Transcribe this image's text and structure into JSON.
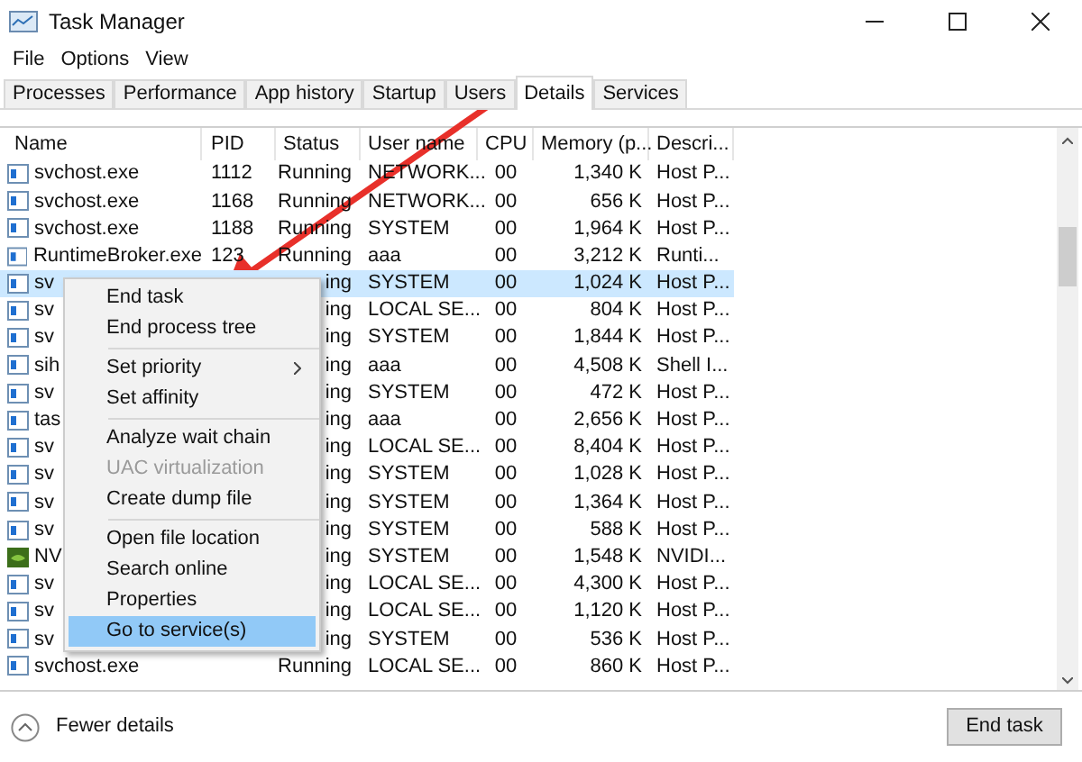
{
  "window": {
    "title": "Task Manager"
  },
  "menu_bar": [
    "File",
    "Options",
    "View"
  ],
  "tabs": [
    {
      "label": "Processes",
      "selected": false
    },
    {
      "label": "Performance",
      "selected": false
    },
    {
      "label": "App history",
      "selected": false
    },
    {
      "label": "Startup",
      "selected": false
    },
    {
      "label": "Users",
      "selected": false
    },
    {
      "label": "Details",
      "selected": true
    },
    {
      "label": "Services",
      "selected": false
    }
  ],
  "table": {
    "columns": [
      "Name",
      "PID",
      "Status",
      "User name",
      "CPU",
      "Memory (p...",
      "Descri..."
    ],
    "rows": [
      {
        "kind": "app",
        "name": "svchost.exe",
        "pid": "1112",
        "status": "Running",
        "user": "NETWORK...",
        "cpu": "00",
        "memory": "1,340 K",
        "description": "Host P...",
        "selected": false
      },
      {
        "kind": "app",
        "name": "svchost.exe",
        "pid": "1168",
        "status": "Running",
        "user": "NETWORK...",
        "cpu": "00",
        "memory": "656 K",
        "description": "Host P...",
        "selected": false
      },
      {
        "kind": "app",
        "name": "svchost.exe",
        "pid": "1188",
        "status": "Running",
        "user": "SYSTEM",
        "cpu": "00",
        "memory": "1,964 K",
        "description": "Host P...",
        "selected": false
      },
      {
        "kind": "app",
        "name": "RuntimeBroker.exe",
        "pid": "123",
        "status": "Running",
        "user": "aaa",
        "cpu": "00",
        "memory": "3,212 K",
        "description": "Runti...",
        "selected": false
      },
      {
        "kind": "app",
        "name": "sv",
        "status": "ing",
        "user": "SYSTEM",
        "cpu": "00",
        "memory": "1,024 K",
        "description": "Host P...",
        "selected": true
      },
      {
        "kind": "app",
        "name": "sv",
        "status": "ing",
        "user": "LOCAL SE...",
        "cpu": "00",
        "memory": "804 K",
        "description": "Host P...",
        "selected": false
      },
      {
        "kind": "app",
        "name": "sv",
        "status": "ing",
        "user": "SYSTEM",
        "cpu": "00",
        "memory": "1,844 K",
        "description": "Host P...",
        "selected": false
      },
      {
        "kind": "app",
        "name": "sih",
        "status": "ing",
        "user": "aaa",
        "cpu": "00",
        "memory": "4,508 K",
        "description": "Shell I...",
        "selected": false
      },
      {
        "kind": "app",
        "name": "sv",
        "status": "ing",
        "user": "SYSTEM",
        "cpu": "00",
        "memory": "472 K",
        "description": "Host P...",
        "selected": false
      },
      {
        "kind": "app",
        "name": "tas",
        "status": "ing",
        "user": "aaa",
        "cpu": "00",
        "memory": "2,656 K",
        "description": "Host P...",
        "selected": false
      },
      {
        "kind": "app",
        "name": "sv",
        "status": "ing",
        "user": "LOCAL SE...",
        "cpu": "00",
        "memory": "8,404 K",
        "description": "Host P...",
        "selected": false
      },
      {
        "kind": "app",
        "name": "sv",
        "status": "ing",
        "user": "SYSTEM",
        "cpu": "00",
        "memory": "1,028 K",
        "description": "Host P...",
        "selected": false
      },
      {
        "kind": "app",
        "name": "sv",
        "status": "ing",
        "user": "SYSTEM",
        "cpu": "00",
        "memory": "1,364 K",
        "description": "Host P...",
        "selected": false
      },
      {
        "kind": "app",
        "name": "sv",
        "status": "ing",
        "user": "SYSTEM",
        "cpu": "00",
        "memory": "588 K",
        "description": "Host P...",
        "selected": false
      },
      {
        "kind": "nvidia",
        "name": "NV",
        "status": "ing",
        "user": "SYSTEM",
        "cpu": "00",
        "memory": "1,548 K",
        "description": "NVIDI...",
        "selected": false
      },
      {
        "kind": "app",
        "name": "sv",
        "status": "ing",
        "user": "LOCAL SE...",
        "cpu": "00",
        "memory": "4,300 K",
        "description": "Host P...",
        "selected": false
      },
      {
        "kind": "app",
        "name": "sv",
        "status": "ing",
        "user": "LOCAL SE...",
        "cpu": "00",
        "memory": "1,120 K",
        "description": "Host P...",
        "selected": false
      },
      {
        "kind": "app",
        "name": "sv",
        "status": "ing",
        "user": "SYSTEM",
        "cpu": "00",
        "memory": "536 K",
        "description": "Host P...",
        "selected": false
      },
      {
        "kind": "app",
        "name": "svchost.exe",
        "status": "Running",
        "user": "LOCAL SE...",
        "cpu": "00",
        "memory": "860 K",
        "description": "Host P...",
        "selected": false
      }
    ]
  },
  "context_menu": [
    {
      "kind": "item",
      "label": "End task",
      "disabled": false,
      "selected": false,
      "submenu": false
    },
    {
      "kind": "item",
      "label": "End process tree",
      "disabled": false,
      "selected": false,
      "submenu": false
    },
    {
      "kind": "separator"
    },
    {
      "kind": "item",
      "label": "Set priority",
      "disabled": false,
      "selected": false,
      "submenu": true
    },
    {
      "kind": "item",
      "label": "Set affinity",
      "disabled": false,
      "selected": false,
      "submenu": false
    },
    {
      "kind": "separator"
    },
    {
      "kind": "item",
      "label": "Analyze wait chain",
      "disabled": false,
      "selected": false,
      "submenu": false
    },
    {
      "kind": "item",
      "label": "UAC virtualization",
      "disabled": true,
      "selected": false,
      "submenu": false
    },
    {
      "kind": "item",
      "label": "Create dump file",
      "disabled": false,
      "selected": false,
      "submenu": false
    },
    {
      "kind": "separator"
    },
    {
      "kind": "item",
      "label": "Open file location",
      "disabled": false,
      "selected": false,
      "submenu": false
    },
    {
      "kind": "item",
      "label": "Search online",
      "disabled": false,
      "selected": false,
      "submenu": false
    },
    {
      "kind": "item",
      "label": "Properties",
      "disabled": false,
      "selected": false,
      "submenu": false
    },
    {
      "kind": "item",
      "label": "Go to service(s)",
      "disabled": false,
      "selected": true,
      "submenu": false
    }
  ],
  "footer": {
    "toggle": "Fewer details",
    "button": "End task"
  }
}
